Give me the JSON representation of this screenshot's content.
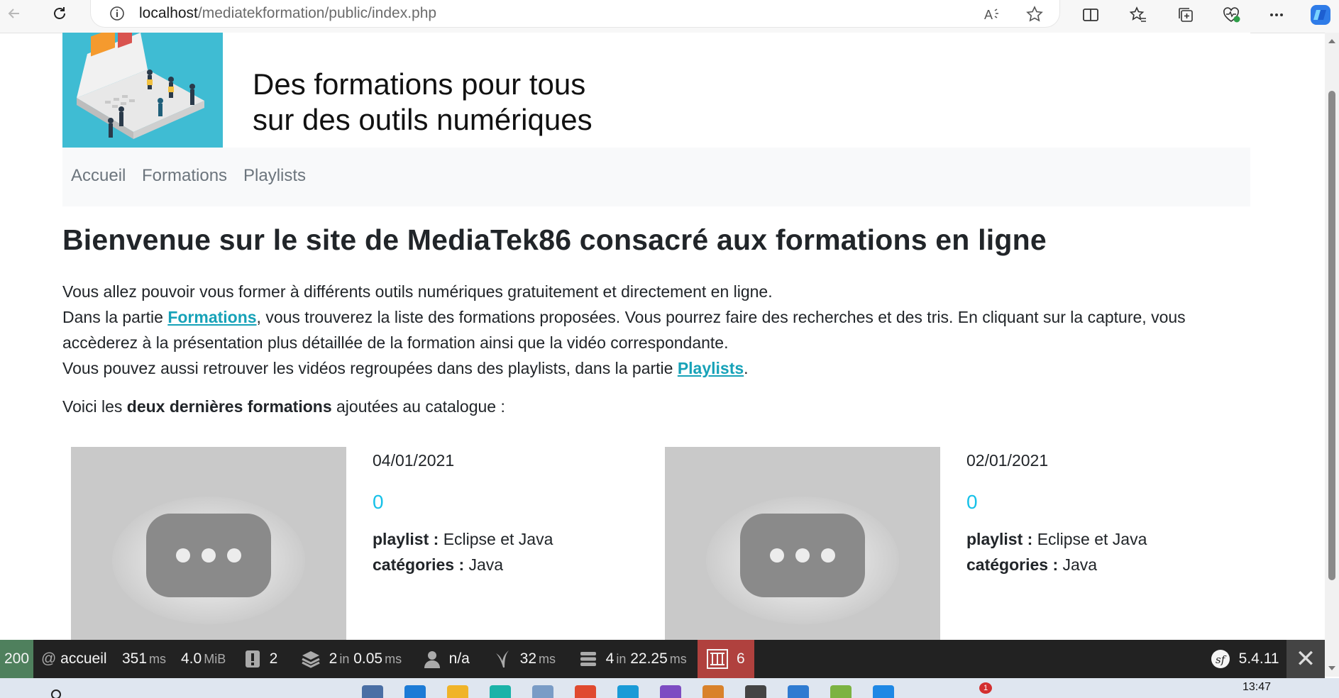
{
  "browser": {
    "url_host": "localhost",
    "url_path": "/mediatekformation/public/index.php"
  },
  "banner": {
    "title_line1": "Des formations pour tous",
    "title_line2": "sur des outils numériques"
  },
  "nav": {
    "items": [
      {
        "label": "Accueil"
      },
      {
        "label": "Formations"
      },
      {
        "label": "Playlists"
      }
    ]
  },
  "page": {
    "title": "Bienvenue sur le site de MediaTek86 consacré aux formations en ligne",
    "p1": "Vous allez pouvoir vous former à différents outils numériques gratuitement et directement en ligne.",
    "p2_before": "Dans la partie ",
    "p2_link": "Formations",
    "p2_after": ", vous trouverez la liste des formations proposées. Vous pourrez faire des recherches et des tris. En cliquant sur la capture, vous accèderez à la présentation plus détaillée de la formation ainsi que la vidéo correspondante.",
    "p3_before": "Vous pouvez aussi retrouver les vidéos regroupées dans des playlists, dans la partie ",
    "p3_link": "Playlists",
    "p3_after": ".",
    "lead_before": "Voici les ",
    "lead_bold": "deux dernières formations",
    "lead_after": " ajoutées au catalogue :"
  },
  "formations": [
    {
      "date": "04/01/2021",
      "count": "0",
      "playlist_label": "playlist :",
      "playlist": "Eclipse et Java",
      "categories_label": "catégories :",
      "categories": "Java"
    },
    {
      "date": "02/01/2021",
      "count": "0",
      "playlist_label": "playlist :",
      "playlist": "Eclipse et Java",
      "categories_label": "catégories :",
      "categories": "Java"
    }
  ],
  "debug_toolbar": {
    "status": "200",
    "route": "accueil",
    "time_value": "351",
    "time_unit": "ms",
    "memory_value": "4.0",
    "memory_unit": "MiB",
    "logs_count": "2",
    "cache_value": "2",
    "cache_in": "in",
    "cache_time": "0.05",
    "cache_unit": "ms",
    "user": "n/a",
    "twig_value": "32",
    "twig_unit": "ms",
    "db_value": "4",
    "db_in": "in",
    "db_time": "22.25",
    "db_unit": "ms",
    "errors_count": "6",
    "symfony_version": "5.4.11"
  },
  "taskbar": {
    "clock": "13:47",
    "badge": "1"
  },
  "colors": {
    "link": "#17a2b8",
    "count": "#17c1e8",
    "toolbar_bg": "#222222",
    "status_ok": "#4f805d",
    "error": "#b0413e"
  }
}
